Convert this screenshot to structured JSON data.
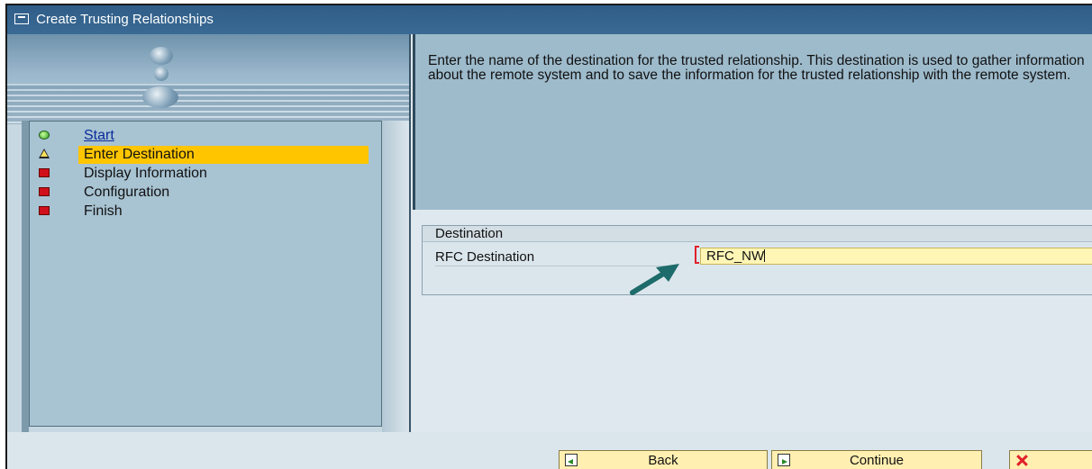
{
  "window": {
    "title": "Create Trusting Relationships"
  },
  "wizard": {
    "steps": [
      {
        "label": "Start",
        "status": "done",
        "icon": "green-light-icon"
      },
      {
        "label": "Enter Destination",
        "status": "current",
        "icon": "yellow-triangle-icon"
      },
      {
        "label": "Display Information",
        "status": "pending",
        "icon": "red-light-icon"
      },
      {
        "label": "Configuration",
        "status": "pending",
        "icon": "red-light-icon"
      },
      {
        "label": "Finish",
        "status": "pending",
        "icon": "red-light-icon"
      }
    ]
  },
  "info": {
    "text": "Enter the name of the destination for the trusted relationship. This destination is used to gather information about the remote system and to save the information for the trusted relationship with the remote system."
  },
  "destination_group": {
    "title": "Destination",
    "field_label": "RFC Destination",
    "field_value": "RFC_NW"
  },
  "footer": {
    "back_label": "Back",
    "continue_label": "Continue",
    "cancel_label": ""
  },
  "colors": {
    "titlebar": "#2f5d87",
    "highlight": "#ffc600",
    "field_background": "#fff6b6",
    "arrow": "#1d6b6a"
  }
}
